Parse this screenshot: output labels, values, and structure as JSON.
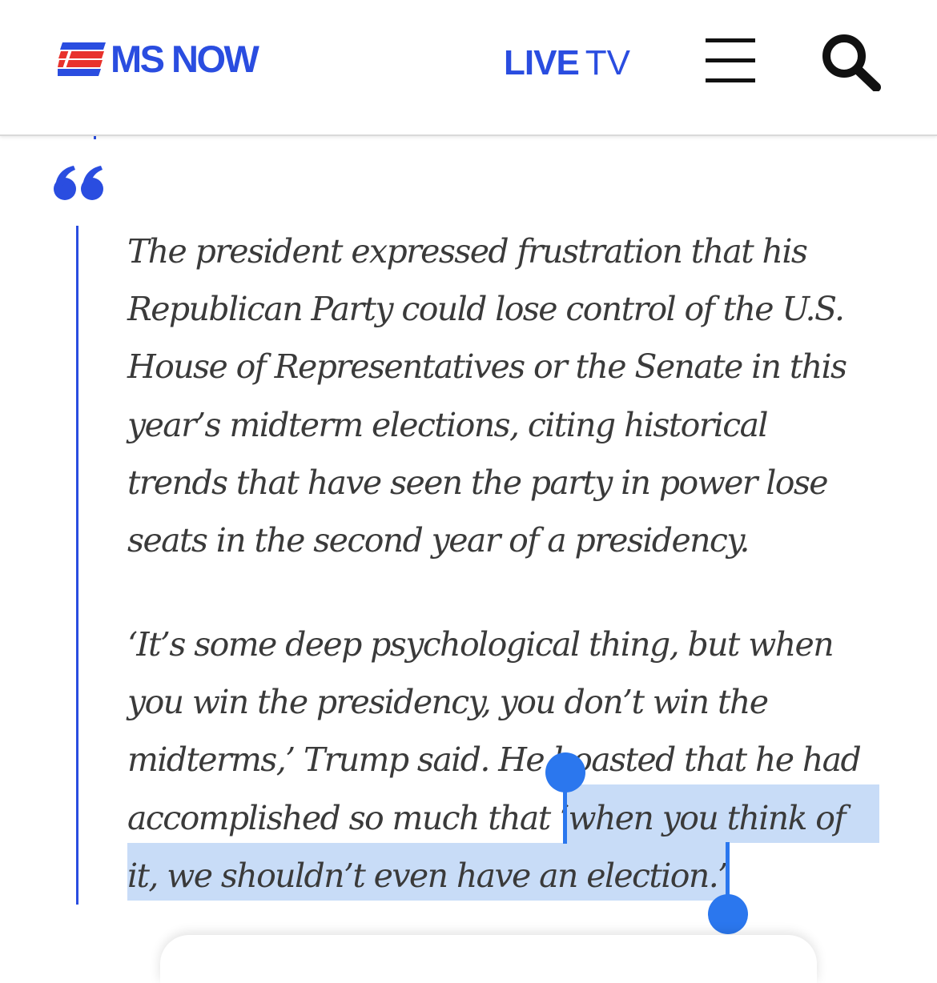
{
  "header": {
    "logo_text": "MS NOW",
    "live_label": "LIVE",
    "tv_label": "TV",
    "menu_icon": "hamburger-menu-icon",
    "search_icon": "search-icon"
  },
  "article": {
    "quote_icon": "quote-mark-icon",
    "paragraph_1_lines": [
      "The president expressed frustration that his",
      "Republican Party could lose control of the U.S.",
      "House of Representatives or the Senate in this",
      "year’s midterm elections, citing historical",
      "trends that have seen the party in power lose",
      "seats in the second year of a presidency."
    ],
    "paragraph_2_lines": [
      "‘It’s some deep psychological thing, but when",
      "you win the presidency, you don’t win the",
      "midterms,’ Trump said. He boasted that he had",
      "accomplished so much that ‘when you think of",
      "it, we shouldn’t even have an election.’"
    ],
    "selected_text": "‘when you think of it, we shouldn’t even have an election.’"
  },
  "colors": {
    "brand_blue": "#2a4de0",
    "brand_red": "#e8322c",
    "body_text": "#3a3a3a",
    "selection_fill": "#c8dcf7",
    "selection_handle": "#2b77ee"
  }
}
